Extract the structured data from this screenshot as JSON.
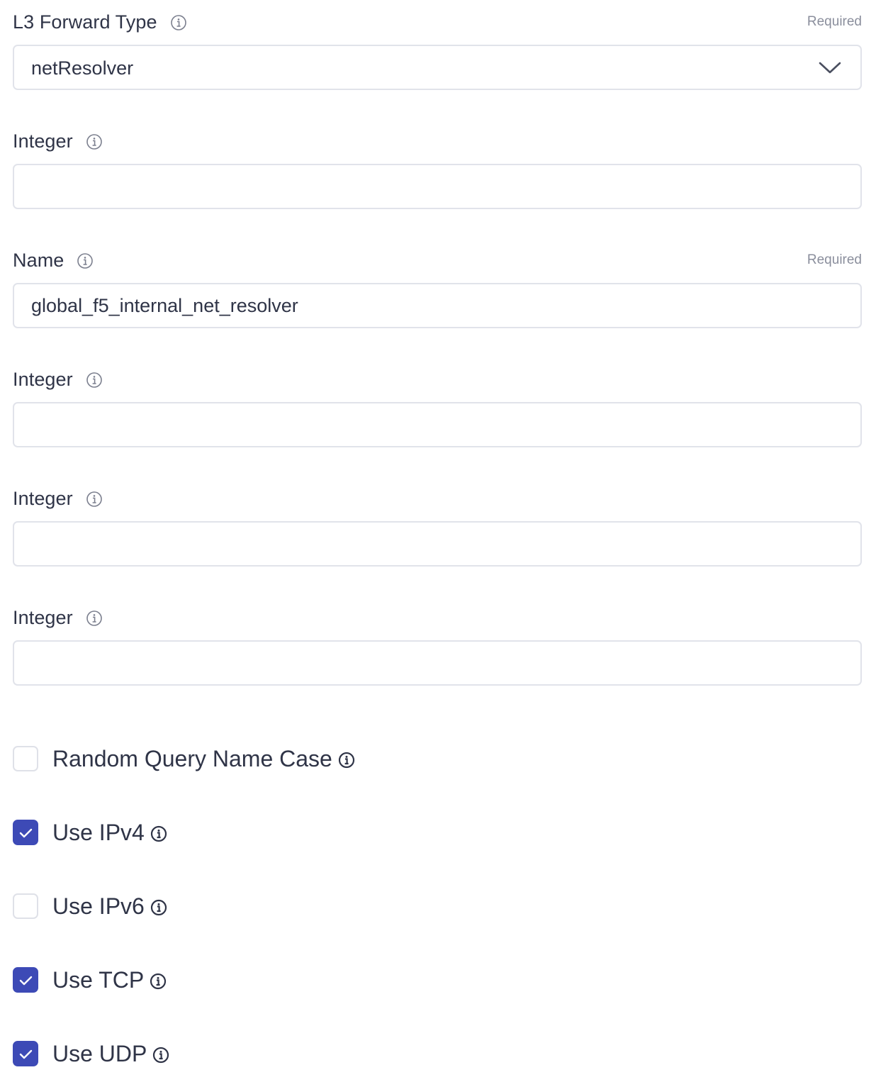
{
  "fields": [
    {
      "label": "L3 Forward Type",
      "required": "Required",
      "type": "select",
      "value": "netResolver",
      "placeholder": ""
    },
    {
      "label": "Integer",
      "required": "",
      "type": "input",
      "value": "",
      "placeholder": ""
    },
    {
      "label": "Name",
      "required": "Required",
      "type": "input",
      "value": "global_f5_internal_net_resolver",
      "placeholder": ""
    },
    {
      "label": "Integer",
      "required": "",
      "type": "input",
      "value": "",
      "placeholder": ""
    },
    {
      "label": "Integer",
      "required": "",
      "type": "input",
      "value": "",
      "placeholder": ""
    },
    {
      "label": "Integer",
      "required": "",
      "type": "input",
      "value": "",
      "placeholder": ""
    }
  ],
  "checkboxes": [
    {
      "label": "Random Query Name Case",
      "checked": false
    },
    {
      "label": "Use IPv4",
      "checked": true
    },
    {
      "label": "Use IPv6",
      "checked": false
    },
    {
      "label": "Use TCP",
      "checked": true
    },
    {
      "label": "Use UDP",
      "checked": true
    }
  ],
  "icons": {
    "info": "info-circle-icon",
    "chevron": "chevron-down-icon",
    "check": "checkmark-icon"
  },
  "colors": {
    "text": "#2f3447",
    "muted": "#8a8e9c",
    "border": "#e1e3ea",
    "accent": "#3d4ab6"
  }
}
